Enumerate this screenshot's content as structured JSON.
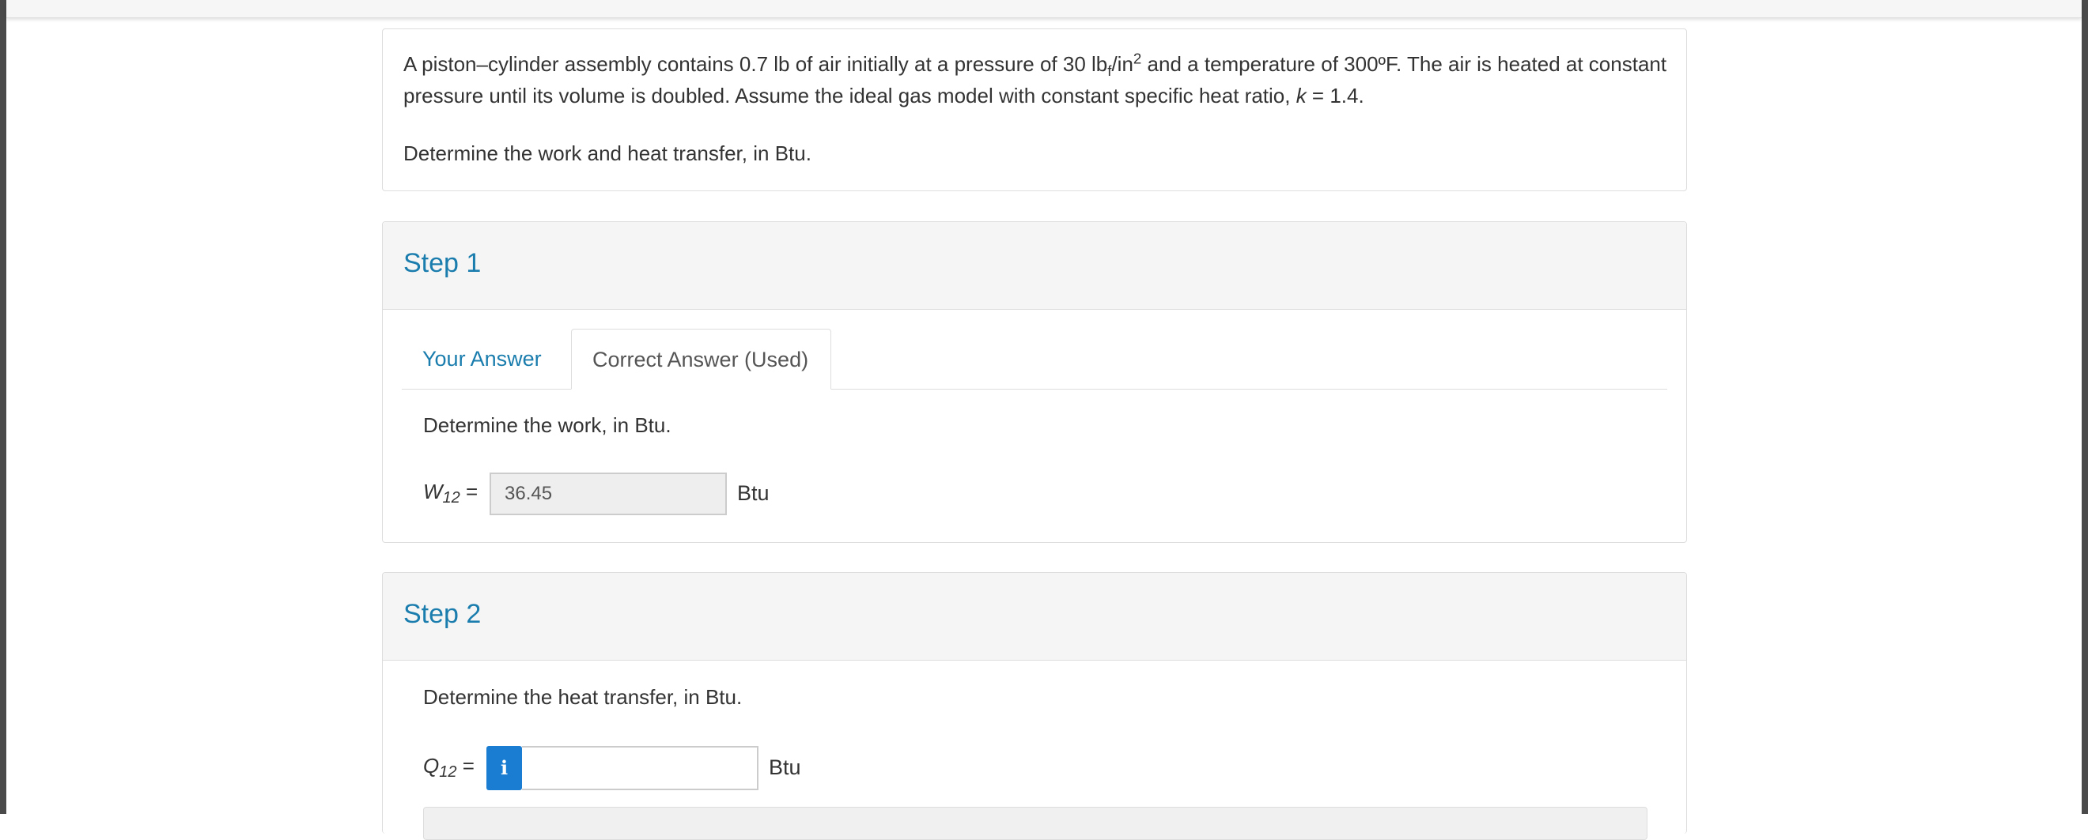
{
  "question": {
    "line1_a": "A piston–cylinder assembly contains 0.7 lb of air initially at a pressure of 30 lb",
    "line1_sub": "f",
    "line1_b": "/in",
    "line1_sup": "2",
    "line1_c": " and a temperature of 300ºF. The air is heated at constant pressure until its volume is doubled. Assume the ideal gas model with constant specific heat ratio, ",
    "line1_k": "k",
    "line1_d": " = 1.4.",
    "task": "Determine the work and heat transfer, in Btu."
  },
  "step1": {
    "title": "Step 1",
    "tabs": [
      {
        "label": "Your Answer",
        "active": false
      },
      {
        "label": "Correct Answer (Used)",
        "active": true
      }
    ],
    "prompt": "Determine the work, in Btu.",
    "var_symbol": "W",
    "var_sub": "12",
    "var_eq": " =",
    "value": "36.45",
    "unit": "Btu"
  },
  "step2": {
    "title": "Step 2",
    "prompt": "Determine the heat transfer, in Btu.",
    "var_symbol": "Q",
    "var_sub": "12",
    "var_eq": " =",
    "info_icon_glyph": "i",
    "value": "",
    "unit": "Btu"
  },
  "colors": {
    "accent": "#1a7dad",
    "info_button": "#1a7dd1",
    "header_bg": "#f5f5f5",
    "border": "#dddddd"
  },
  "icons": {
    "info": "info-icon"
  }
}
